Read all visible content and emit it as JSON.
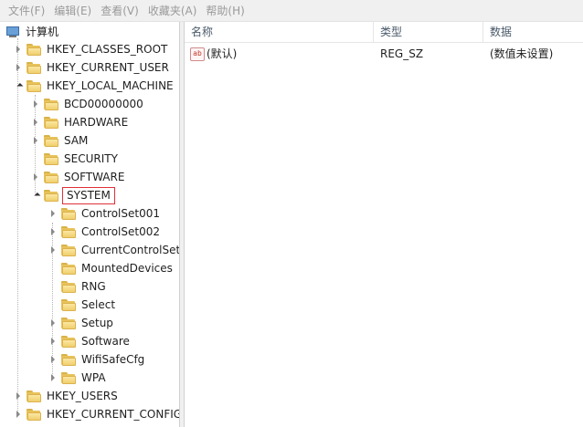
{
  "menu": [
    "文件(F)",
    "编辑(E)",
    "查看(V)",
    "收藏夹(A)",
    "帮助(H)"
  ],
  "tree": {
    "root": "计算机",
    "nodes": [
      {
        "label": "HKEY_CLASSES_ROOT",
        "level": 1,
        "state": "closed"
      },
      {
        "label": "HKEY_CURRENT_USER",
        "level": 1,
        "state": "closed"
      },
      {
        "label": "HKEY_LOCAL_MACHINE",
        "level": 1,
        "state": "open"
      },
      {
        "label": "BCD00000000",
        "level": 2,
        "state": "closed"
      },
      {
        "label": "HARDWARE",
        "level": 2,
        "state": "closed"
      },
      {
        "label": "SAM",
        "level": 2,
        "state": "closed"
      },
      {
        "label": "SECURITY",
        "level": 2,
        "state": "none"
      },
      {
        "label": "SOFTWARE",
        "level": 2,
        "state": "closed"
      },
      {
        "label": "SYSTEM",
        "level": 2,
        "state": "open",
        "selected": true
      },
      {
        "label": "ControlSet001",
        "level": 3,
        "state": "closed"
      },
      {
        "label": "ControlSet002",
        "level": 3,
        "state": "closed"
      },
      {
        "label": "CurrentControlSet",
        "level": 3,
        "state": "closed"
      },
      {
        "label": "MountedDevices",
        "level": 3,
        "state": "none"
      },
      {
        "label": "RNG",
        "level": 3,
        "state": "none"
      },
      {
        "label": "Select",
        "level": 3,
        "state": "none"
      },
      {
        "label": "Setup",
        "level": 3,
        "state": "closed"
      },
      {
        "label": "Software",
        "level": 3,
        "state": "closed"
      },
      {
        "label": "WifiSafeCfg",
        "level": 3,
        "state": "closed"
      },
      {
        "label": "WPA",
        "level": 3,
        "state": "closed"
      },
      {
        "label": "HKEY_USERS",
        "level": 1,
        "state": "closed"
      },
      {
        "label": "HKEY_CURRENT_CONFIG",
        "level": 1,
        "state": "closed"
      }
    ]
  },
  "list": {
    "columns": [
      "名称",
      "类型",
      "数据"
    ],
    "rows": [
      {
        "name": "(默认)",
        "type": "REG_SZ",
        "data": "(数值未设置)",
        "icon": "ab"
      }
    ]
  }
}
